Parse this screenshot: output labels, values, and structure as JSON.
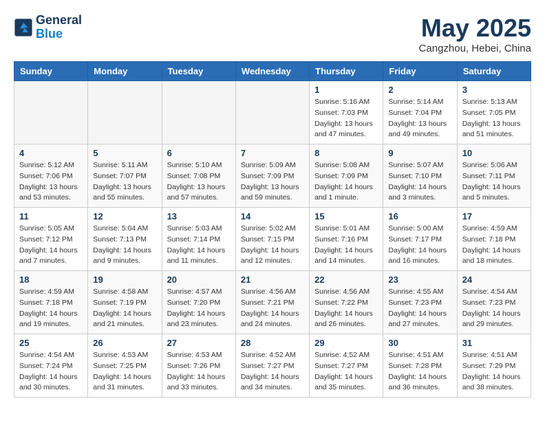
{
  "header": {
    "logo_line1": "General",
    "logo_line2": "Blue",
    "month": "May 2025",
    "location": "Cangzhou, Hebei, China"
  },
  "weekdays": [
    "Sunday",
    "Monday",
    "Tuesday",
    "Wednesday",
    "Thursday",
    "Friday",
    "Saturday"
  ],
  "weeks": [
    [
      {
        "day": "",
        "info": ""
      },
      {
        "day": "",
        "info": ""
      },
      {
        "day": "",
        "info": ""
      },
      {
        "day": "",
        "info": ""
      },
      {
        "day": "1",
        "info": "Sunrise: 5:16 AM\nSunset: 7:03 PM\nDaylight: 13 hours\nand 47 minutes."
      },
      {
        "day": "2",
        "info": "Sunrise: 5:14 AM\nSunset: 7:04 PM\nDaylight: 13 hours\nand 49 minutes."
      },
      {
        "day": "3",
        "info": "Sunrise: 5:13 AM\nSunset: 7:05 PM\nDaylight: 13 hours\nand 51 minutes."
      }
    ],
    [
      {
        "day": "4",
        "info": "Sunrise: 5:12 AM\nSunset: 7:06 PM\nDaylight: 13 hours\nand 53 minutes."
      },
      {
        "day": "5",
        "info": "Sunrise: 5:11 AM\nSunset: 7:07 PM\nDaylight: 13 hours\nand 55 minutes."
      },
      {
        "day": "6",
        "info": "Sunrise: 5:10 AM\nSunset: 7:08 PM\nDaylight: 13 hours\nand 57 minutes."
      },
      {
        "day": "7",
        "info": "Sunrise: 5:09 AM\nSunset: 7:09 PM\nDaylight: 13 hours\nand 59 minutes."
      },
      {
        "day": "8",
        "info": "Sunrise: 5:08 AM\nSunset: 7:09 PM\nDaylight: 14 hours\nand 1 minute."
      },
      {
        "day": "9",
        "info": "Sunrise: 5:07 AM\nSunset: 7:10 PM\nDaylight: 14 hours\nand 3 minutes."
      },
      {
        "day": "10",
        "info": "Sunrise: 5:06 AM\nSunset: 7:11 PM\nDaylight: 14 hours\nand 5 minutes."
      }
    ],
    [
      {
        "day": "11",
        "info": "Sunrise: 5:05 AM\nSunset: 7:12 PM\nDaylight: 14 hours\nand 7 minutes."
      },
      {
        "day": "12",
        "info": "Sunrise: 5:04 AM\nSunset: 7:13 PM\nDaylight: 14 hours\nand 9 minutes."
      },
      {
        "day": "13",
        "info": "Sunrise: 5:03 AM\nSunset: 7:14 PM\nDaylight: 14 hours\nand 11 minutes."
      },
      {
        "day": "14",
        "info": "Sunrise: 5:02 AM\nSunset: 7:15 PM\nDaylight: 14 hours\nand 12 minutes."
      },
      {
        "day": "15",
        "info": "Sunrise: 5:01 AM\nSunset: 7:16 PM\nDaylight: 14 hours\nand 14 minutes."
      },
      {
        "day": "16",
        "info": "Sunrise: 5:00 AM\nSunset: 7:17 PM\nDaylight: 14 hours\nand 16 minutes."
      },
      {
        "day": "17",
        "info": "Sunrise: 4:59 AM\nSunset: 7:18 PM\nDaylight: 14 hours\nand 18 minutes."
      }
    ],
    [
      {
        "day": "18",
        "info": "Sunrise: 4:59 AM\nSunset: 7:18 PM\nDaylight: 14 hours\nand 19 minutes."
      },
      {
        "day": "19",
        "info": "Sunrise: 4:58 AM\nSunset: 7:19 PM\nDaylight: 14 hours\nand 21 minutes."
      },
      {
        "day": "20",
        "info": "Sunrise: 4:57 AM\nSunset: 7:20 PM\nDaylight: 14 hours\nand 23 minutes."
      },
      {
        "day": "21",
        "info": "Sunrise: 4:56 AM\nSunset: 7:21 PM\nDaylight: 14 hours\nand 24 minutes."
      },
      {
        "day": "22",
        "info": "Sunrise: 4:56 AM\nSunset: 7:22 PM\nDaylight: 14 hours\nand 26 minutes."
      },
      {
        "day": "23",
        "info": "Sunrise: 4:55 AM\nSunset: 7:23 PM\nDaylight: 14 hours\nand 27 minutes."
      },
      {
        "day": "24",
        "info": "Sunrise: 4:54 AM\nSunset: 7:23 PM\nDaylight: 14 hours\nand 29 minutes."
      }
    ],
    [
      {
        "day": "25",
        "info": "Sunrise: 4:54 AM\nSunset: 7:24 PM\nDaylight: 14 hours\nand 30 minutes."
      },
      {
        "day": "26",
        "info": "Sunrise: 4:53 AM\nSunset: 7:25 PM\nDaylight: 14 hours\nand 31 minutes."
      },
      {
        "day": "27",
        "info": "Sunrise: 4:53 AM\nSunset: 7:26 PM\nDaylight: 14 hours\nand 33 minutes."
      },
      {
        "day": "28",
        "info": "Sunrise: 4:52 AM\nSunset: 7:27 PM\nDaylight: 14 hours\nand 34 minutes."
      },
      {
        "day": "29",
        "info": "Sunrise: 4:52 AM\nSunset: 7:27 PM\nDaylight: 14 hours\nand 35 minutes."
      },
      {
        "day": "30",
        "info": "Sunrise: 4:51 AM\nSunset: 7:28 PM\nDaylight: 14 hours\nand 36 minutes."
      },
      {
        "day": "31",
        "info": "Sunrise: 4:51 AM\nSunset: 7:29 PM\nDaylight: 14 hours\nand 38 minutes."
      }
    ]
  ]
}
